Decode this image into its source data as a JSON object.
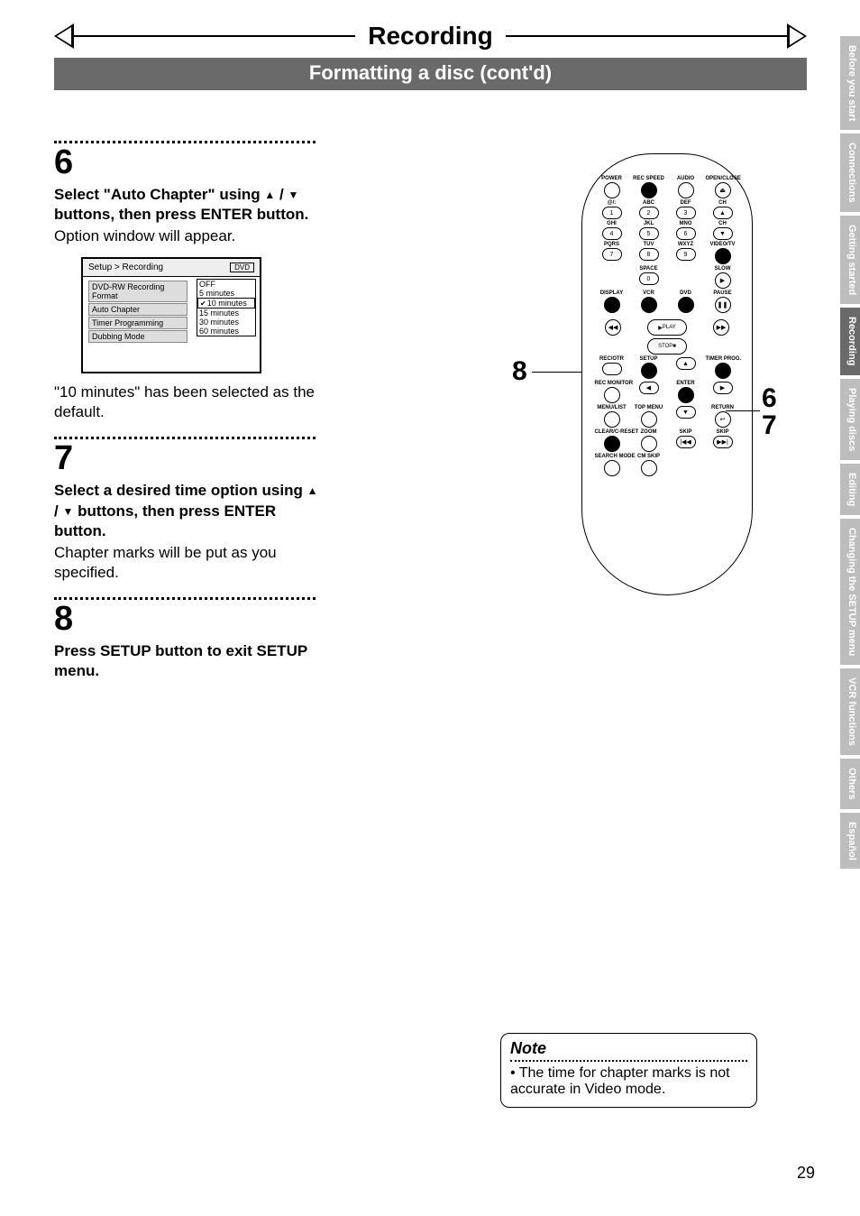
{
  "header": {
    "title": "Recording",
    "subtitle": "Formatting a disc (cont'd)"
  },
  "steps": {
    "s6": {
      "num": "6",
      "bold1": "Select \"Auto Chapter\" using",
      "bold2": " buttons, then press ENTER button.",
      "body": "Option window will appear.",
      "after": "\"10 minutes\" has been selected as the default."
    },
    "s7": {
      "num": "7",
      "bold1": "Select a desired time option using ",
      "bold2": " buttons, then press ENTER button.",
      "body": "Chapter marks will be put as you specified."
    },
    "s8": {
      "num": "8",
      "bold": "Press SETUP button to exit SETUP menu."
    }
  },
  "option_window": {
    "breadcrumb": "Setup > Recording",
    "badge": "DVD",
    "menu": [
      "DVD-RW Recording Format",
      "Auto Chapter",
      "Timer Programming",
      "Dubbing Mode"
    ],
    "options": [
      "OFF",
      "5 minutes",
      "10 minutes",
      "15 minutes",
      "30 minutes",
      "60 minutes"
    ],
    "selected": "10 minutes"
  },
  "remote_callouts": {
    "left": "8",
    "right_top": "6",
    "right_bottom": "7"
  },
  "remote": {
    "row1": [
      "POWER",
      "REC SPEED",
      "AUDIO",
      "OPEN/CLOSE"
    ],
    "row2": [
      "@/:",
      "ABC",
      "DEF",
      "CH"
    ],
    "nums2": [
      "1",
      "2",
      "3",
      "▲"
    ],
    "row3": [
      "GHI",
      "JKL",
      "MNO",
      "CH"
    ],
    "nums3": [
      "4",
      "5",
      "6",
      "▼"
    ],
    "row4": [
      "PQRS",
      "TUV",
      "WXYZ",
      "VIDEO/TV"
    ],
    "nums4": [
      "7",
      "8",
      "9",
      ""
    ],
    "row5": [
      "",
      "SPACE",
      "",
      "SLOW"
    ],
    "nums5": [
      "",
      "0",
      "",
      ""
    ],
    "row6": [
      "DISPLAY",
      "VCR",
      "DVD",
      "PAUSE"
    ],
    "play": "PLAY",
    "stop": "STOP",
    "row7": [
      "REC/OTR",
      "SETUP",
      "",
      "TIMER PROG."
    ],
    "row8": [
      "REC MONITOR",
      "",
      "ENTER",
      ""
    ],
    "row9": [
      "MENU/LIST",
      "TOP MENU",
      "",
      "RETURN"
    ],
    "row10": [
      "CLEAR/C-RESET",
      "ZOOM",
      "SKIP",
      "SKIP"
    ],
    "row11": [
      "SEARCH MODE",
      "CM SKIP",
      "",
      ""
    ]
  },
  "tabs": [
    "Before you start",
    "Connections",
    "Getting started",
    "Recording",
    "Playing discs",
    "Editing",
    "Changing the SETUP menu",
    "VCR functions",
    "Others",
    "Español"
  ],
  "active_tab": "Recording",
  "note": {
    "heading": "Note",
    "text": "• The time for chapter marks is not accurate in Video mode."
  },
  "page_number": "29"
}
